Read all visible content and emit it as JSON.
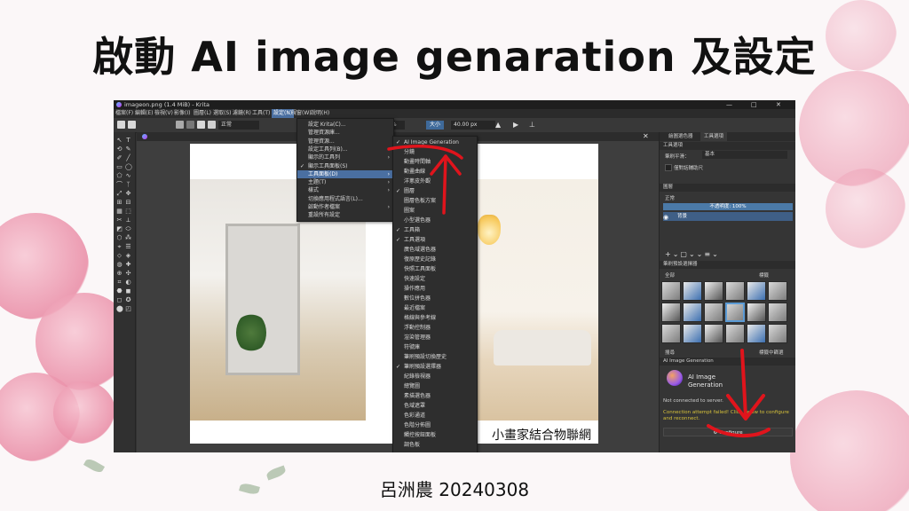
{
  "slide": {
    "title": "啟動 AI image genaration 及設定",
    "author_date": "呂洲農 20240308"
  },
  "window": {
    "title": "imageon.png (1.4 MiB) - Krita",
    "controls": [
      "—",
      "□",
      "✕"
    ]
  },
  "menubar": {
    "items": [
      "檔案(F)",
      "編輯(E)",
      "檢視(V)",
      "影像(I)",
      "圖層(L)",
      "選取(S)",
      "濾鏡(R)",
      "工具(T)",
      "設定(N)",
      "視窗(W)",
      "說明(H)"
    ],
    "active_index": 8
  },
  "toolbar": {
    "mode_label": "正常",
    "opacity_value": "0%",
    "size_label": "大小",
    "size_value": "40.00 px"
  },
  "settings_menu": {
    "items": [
      {
        "label": "設定 Krita(C)...",
        "arrow": false,
        "check": false
      },
      {
        "label": "管理資源庫...",
        "arrow": false,
        "check": false
      },
      {
        "label": "管理資源...",
        "arrow": false,
        "check": false
      },
      {
        "label": "設定工具列(B)...",
        "arrow": false,
        "check": false
      },
      {
        "label": "顯示的工具列",
        "arrow": true,
        "check": false
      },
      {
        "label": "顯示工具面板(S)",
        "arrow": false,
        "check": true
      },
      {
        "label": "工具面板(D)",
        "arrow": true,
        "check": false,
        "highlight": true
      },
      {
        "label": "主題(T)",
        "arrow": true,
        "check": false
      },
      {
        "label": "樣式",
        "arrow": true,
        "check": false
      },
      {
        "label": "切換應用程式語言(L)...",
        "arrow": false,
        "check": false
      },
      {
        "label": "啟動作者檔案",
        "arrow": true,
        "check": false
      },
      {
        "label": "重設所有設定",
        "arrow": false,
        "check": false
      }
    ]
  },
  "dockers_menu": {
    "items": [
      {
        "label": "AI Image Generation",
        "check": true
      },
      {
        "label": "分鏡",
        "check": false
      },
      {
        "label": "動畫時間軸",
        "check": false
      },
      {
        "label": "動畫曲線",
        "check": false
      },
      {
        "label": "洋蔥皮外觀",
        "check": false
      },
      {
        "label": "圖層",
        "check": true
      },
      {
        "label": "圖層色板方案",
        "check": false
      },
      {
        "label": "圖案",
        "check": false
      },
      {
        "label": "小型選色器",
        "check": false
      },
      {
        "label": "工具箱",
        "check": true
      },
      {
        "label": "工具選項",
        "check": true
      },
      {
        "label": "廣色域選色器",
        "check": false
      },
      {
        "label": "復原歷史記錄",
        "check": false
      },
      {
        "label": "快照工具面板",
        "check": false
      },
      {
        "label": "快速設定",
        "check": false
      },
      {
        "label": "操作應用",
        "check": false
      },
      {
        "label": "數位拼色器",
        "check": false
      },
      {
        "label": "最近檔案",
        "check": false
      },
      {
        "label": "格線與參考線",
        "check": false
      },
      {
        "label": "浮動控制器",
        "check": false
      },
      {
        "label": "渲染管理器",
        "check": false
      },
      {
        "label": "符號庫",
        "check": false
      },
      {
        "label": "筆刷預設切換歷史",
        "check": false
      },
      {
        "label": "筆刷預設選擇器",
        "check": true
      },
      {
        "label": "紀錄檢視器",
        "check": false
      },
      {
        "label": "總覽圖",
        "check": false
      },
      {
        "label": "素描選色器",
        "check": false
      },
      {
        "label": "色域遮罩",
        "check": false
      },
      {
        "label": "色彩通道",
        "check": false
      },
      {
        "label": "色階分佈圖",
        "check": false
      },
      {
        "label": "觸控按鈕面板",
        "check": false
      },
      {
        "label": "調色板",
        "check": false
      }
    ]
  },
  "dock": {
    "tabs": [
      "繪圖選色器",
      "工具選項"
    ],
    "tool_options_title": "工具選項",
    "mode_row": "筆刷平滑：",
    "mode_value": "基本",
    "checkbox_label": "僅對話輔助尺",
    "layers_title": "圖層",
    "layer_mode": "正常",
    "opacity_label": "不透明度: 100%",
    "layer_name": "背景",
    "brush_presets_title": "筆刷預設選擇器",
    "brush_filter": "全部",
    "brush_tag": "標籤",
    "brush_search": "搜尋",
    "brush_footer_checkbox": "標籤中篩選",
    "ai_title": "AI Image Generation",
    "ai_logo_text": "AI Image Generation",
    "status": "Not connected to server.",
    "error": "Connection attempt failed! Click below to configure and reconnect.",
    "configure_label": "Configure"
  },
  "canvas": {
    "watermark": "小畫家結合物聯網"
  },
  "colors": {
    "accent": "#4a6fa1",
    "annotation": "#e0141c",
    "warning": "#d6c13a"
  }
}
